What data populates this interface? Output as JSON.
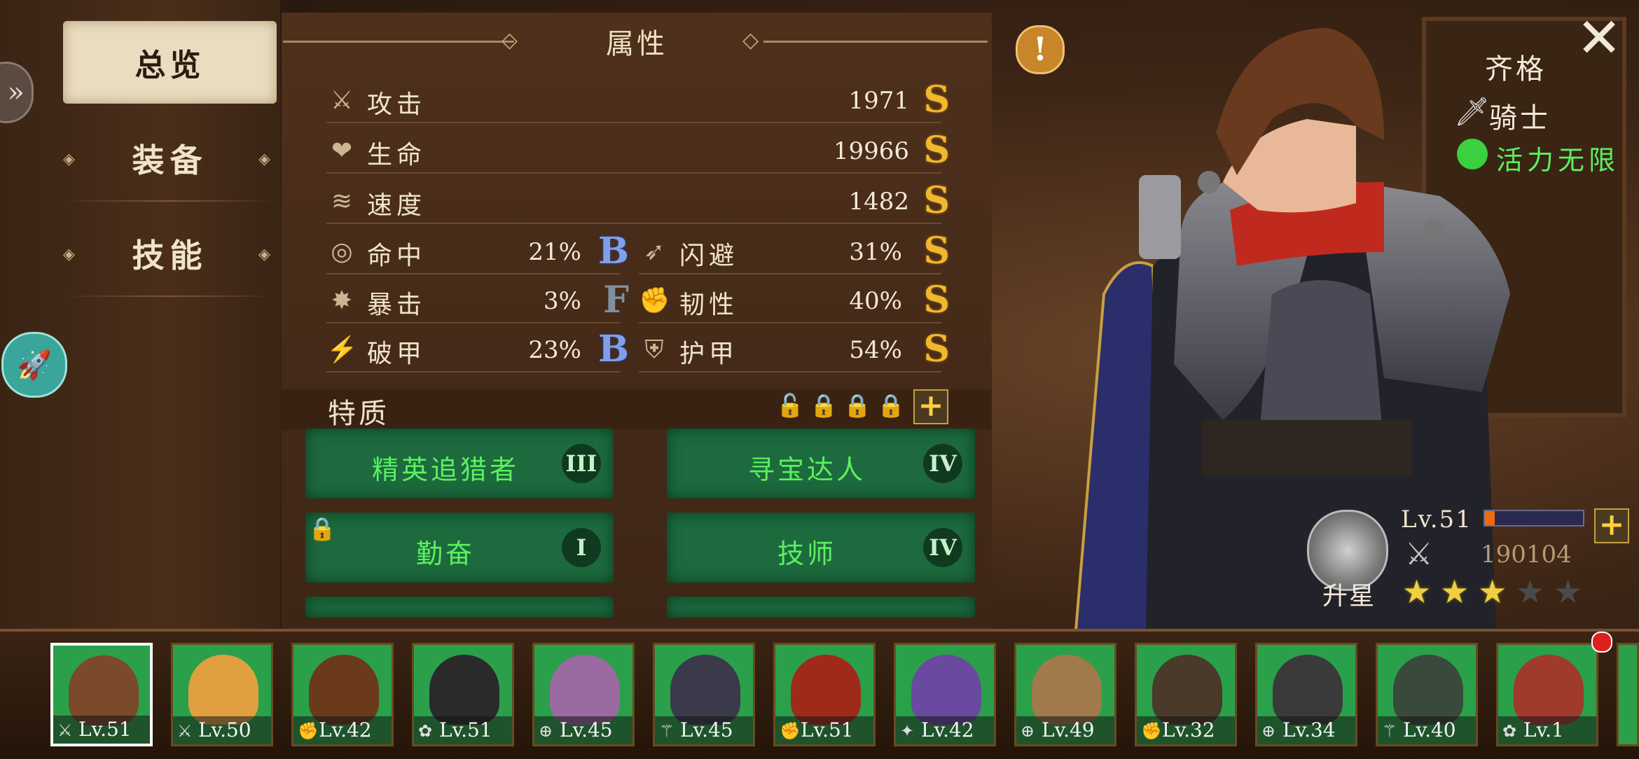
{
  "menu": {
    "tabs": [
      {
        "label": "总览",
        "active": true
      },
      {
        "label": "装备",
        "active": false
      },
      {
        "label": "技能",
        "active": false
      }
    ]
  },
  "stats_panel": {
    "title": "属性",
    "stats_full": [
      {
        "label": "攻击",
        "value": "1971",
        "grade": "S",
        "icon": "sword-icon"
      },
      {
        "label": "生命",
        "value": "19966",
        "grade": "S",
        "icon": "heart-icon"
      },
      {
        "label": "速度",
        "value": "1482",
        "grade": "S",
        "icon": "wind-icon"
      }
    ],
    "stats_half": [
      {
        "label": "命中",
        "value": "21%",
        "grade": "B",
        "icon": "target-icon"
      },
      {
        "label": "闪避",
        "value": "31%",
        "grade": "S",
        "icon": "dodge-icon"
      },
      {
        "label": "暴击",
        "value": "3%",
        "grade": "F",
        "icon": "crit-icon"
      },
      {
        "label": "韧性",
        "value": "40%",
        "grade": "S",
        "icon": "muscle-icon"
      },
      {
        "label": "破甲",
        "value": "23%",
        "grade": "B",
        "icon": "pierce-icon"
      },
      {
        "label": "护甲",
        "value": "54%",
        "grade": "S",
        "icon": "shield-icon"
      }
    ],
    "traits_title": "特质",
    "traits": [
      {
        "name": "精英追猎者",
        "level": "III",
        "locked": false
      },
      {
        "name": "寻宝达人",
        "level": "IV",
        "locked": false
      },
      {
        "name": "勤奋",
        "level": "I",
        "locked": true
      },
      {
        "name": "技师",
        "level": "IV",
        "locked": false
      }
    ]
  },
  "hero": {
    "name": "齐格",
    "class": "骑士",
    "vigor": "活力无限",
    "level": "Lv.51",
    "exp_fraction": 0.1,
    "power": "190104",
    "rank_label": "升星",
    "stars_total": 5,
    "stars_filled": 3
  },
  "roster": [
    {
      "level": "Lv.51",
      "selected": true,
      "class_icon": "sword-icon",
      "color": "#7a4a2a"
    },
    {
      "level": "Lv.50",
      "selected": false,
      "class_icon": "sword-icon",
      "color": "#e0a040"
    },
    {
      "level": "Lv.42",
      "selected": false,
      "class_icon": "fist-icon",
      "color": "#6a3a1a"
    },
    {
      "level": "Lv.51",
      "selected": false,
      "class_icon": "lotus-icon",
      "color": "#2a2a2a"
    },
    {
      "level": "Lv.45",
      "selected": false,
      "class_icon": "crosshair-icon",
      "color": "#9a6aa0"
    },
    {
      "level": "Lv.45",
      "selected": false,
      "class_icon": "staff-icon",
      "color": "#3a3a4a"
    },
    {
      "level": "Lv.51",
      "selected": false,
      "class_icon": "fist-icon",
      "color": "#a02a1a"
    },
    {
      "level": "Lv.42",
      "selected": false,
      "class_icon": "wand-icon",
      "color": "#6a4aa0"
    },
    {
      "level": "Lv.49",
      "selected": false,
      "class_icon": "crosshair-icon",
      "color": "#a07a4a"
    },
    {
      "level": "Lv.32",
      "selected": false,
      "class_icon": "fist-icon",
      "color": "#4a3a2a"
    },
    {
      "level": "Lv.34",
      "selected": false,
      "class_icon": "crosshair-icon",
      "color": "#3a3a3a"
    },
    {
      "level": "Lv.40",
      "selected": false,
      "class_icon": "staff-icon",
      "color": "#3a4a3a"
    },
    {
      "level": "Lv.1",
      "selected": false,
      "class_icon": "lotus-icon",
      "color": "#a03a2a"
    }
  ],
  "colors": {
    "grade_S": "#f0b830",
    "grade_B": "#7fa0e8",
    "grade_F": "#8090a0",
    "trait_green": "#5cf060"
  }
}
